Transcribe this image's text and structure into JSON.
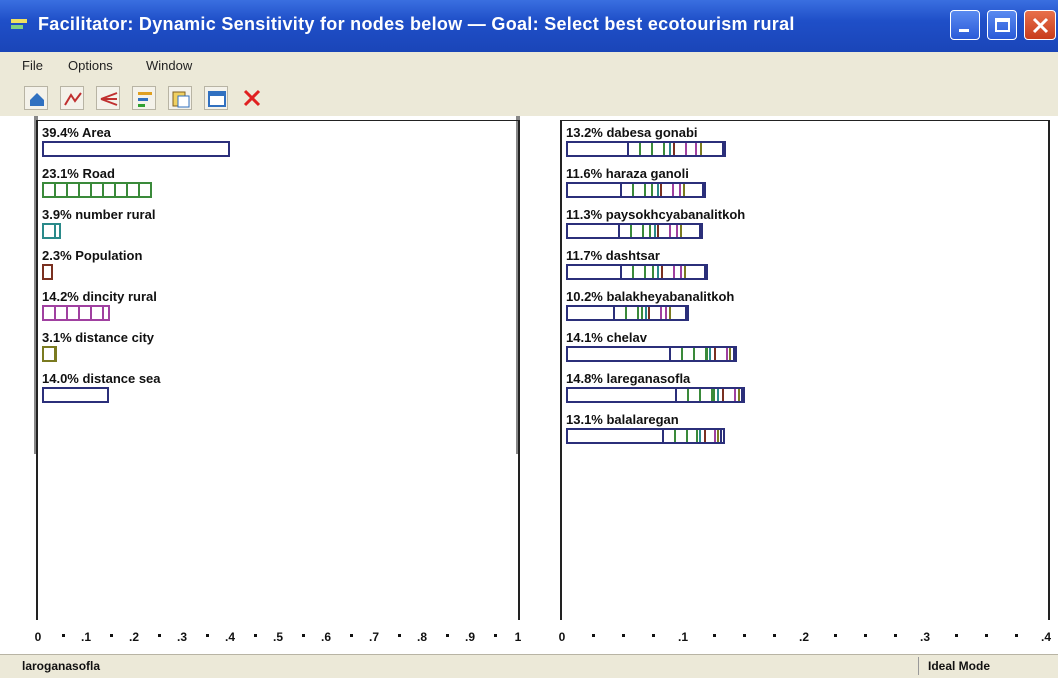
{
  "window": {
    "title": "Facilitator: Dynamic Sensitivity for nodes below — Goal: Select best ecotourism rural",
    "minimize_icon": "minimize-icon",
    "maximize_icon": "maximize-icon",
    "close_icon": "close-icon"
  },
  "menu": [
    "File",
    "Options",
    "Window"
  ],
  "toolbar": {
    "icons": [
      "home-icon",
      "chart-icon",
      "arrows-icon",
      "bars-icon",
      "pages-icon",
      "window-icon",
      "delete-icon"
    ]
  },
  "colors": {
    "title_bar": "#1f4fc8",
    "navy": "#2b2f7a",
    "green": "#3a8a3a",
    "teal": "#2a8a8a",
    "brown": "#7a3020",
    "purple": "#a040a0",
    "olive": "#7a7a20"
  },
  "left_chart": {
    "xlim": [
      0,
      1
    ],
    "tick_labels": [
      "0",
      ".1",
      ".2",
      ".3",
      ".4",
      ".5",
      ".6",
      ".7",
      ".8",
      ".9",
      "1"
    ],
    "rows": [
      {
        "label": "39.4% Area",
        "value": 0.394,
        "color": "navy"
      },
      {
        "label": "23.1% Road",
        "value": 0.231,
        "color": "green"
      },
      {
        "label": "3.9% number rural",
        "value": 0.039,
        "color": "teal"
      },
      {
        "label": "2.3% Population",
        "value": 0.023,
        "color": "brown"
      },
      {
        "label": "14.2% dincity rural",
        "value": 0.142,
        "color": "purple"
      },
      {
        "label": "3.1% distance city",
        "value": 0.031,
        "color": "olive"
      },
      {
        "label": "14.0% distance sea",
        "value": 0.14,
        "color": "navy"
      }
    ]
  },
  "right_chart": {
    "xlim": [
      0,
      0.4
    ],
    "tick_labels": [
      "0",
      ".1",
      ".2",
      ".3",
      ".4"
    ],
    "rows": [
      {
        "label": "13.2% dabesa gonabi",
        "value": 0.132
      },
      {
        "label": "11.6% haraza ganoli",
        "value": 0.116
      },
      {
        "label": "11.3% paysokhcyabanalitkoh",
        "value": 0.113
      },
      {
        "label": "11.7% dashtsar",
        "value": 0.117
      },
      {
        "label": "10.2% balakheyabanalitkoh",
        "value": 0.102
      },
      {
        "label": "14.1% chelav",
        "value": 0.141
      },
      {
        "label": "14.8% lareganasofla",
        "value": 0.148
      },
      {
        "label": "13.1% balalaregan",
        "value": 0.131
      }
    ]
  },
  "status": {
    "left": "laroganasofla",
    "right": "Ideal Mode"
  }
}
